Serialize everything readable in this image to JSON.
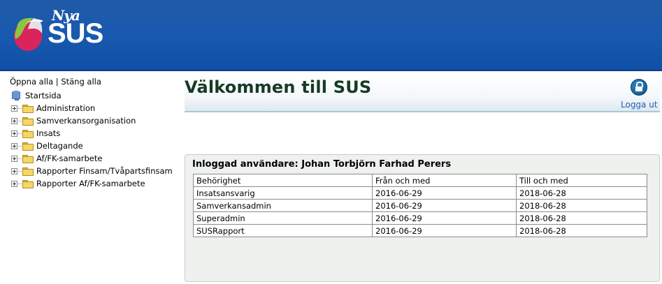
{
  "header": {
    "logo_small": "Nya",
    "logo_big": "SUS"
  },
  "sidebar": {
    "expand_all": "Öppna alla",
    "separator": "|",
    "collapse_all": "Stäng alla",
    "root": "Startsida",
    "items": [
      {
        "label": "Administration"
      },
      {
        "label": "Samverkansorganisation"
      },
      {
        "label": "Insats"
      },
      {
        "label": "Deltagande"
      },
      {
        "label": "Af/FK-samarbete"
      },
      {
        "label": "Rapporter Finsam/Tvåpartsfinsam"
      },
      {
        "label": "Rapporter Af/FK-samarbete"
      }
    ]
  },
  "main": {
    "title": "Välkommen till SUS",
    "logout": "Logga ut",
    "user_heading": "Inloggad användare: Johan Torbjörn Farhad Perers",
    "table": {
      "headers": [
        "Behörighet",
        "Från och med",
        "Till och med"
      ],
      "rows": [
        [
          "Insatsansvarig",
          "2016-06-29",
          "2018-06-28"
        ],
        [
          "Samverkansadmin",
          "2016-06-29",
          "2018-06-28"
        ],
        [
          "Superadmin",
          "2016-06-29",
          "2018-06-28"
        ],
        [
          "SUSRapport",
          "2016-06-29",
          "2018-06-28"
        ]
      ]
    }
  },
  "colors": {
    "header_blue": "#1a59b0",
    "title_green": "#173a26",
    "link_blue": "#1f5ea8",
    "panel_bg": "#eef1ee"
  }
}
